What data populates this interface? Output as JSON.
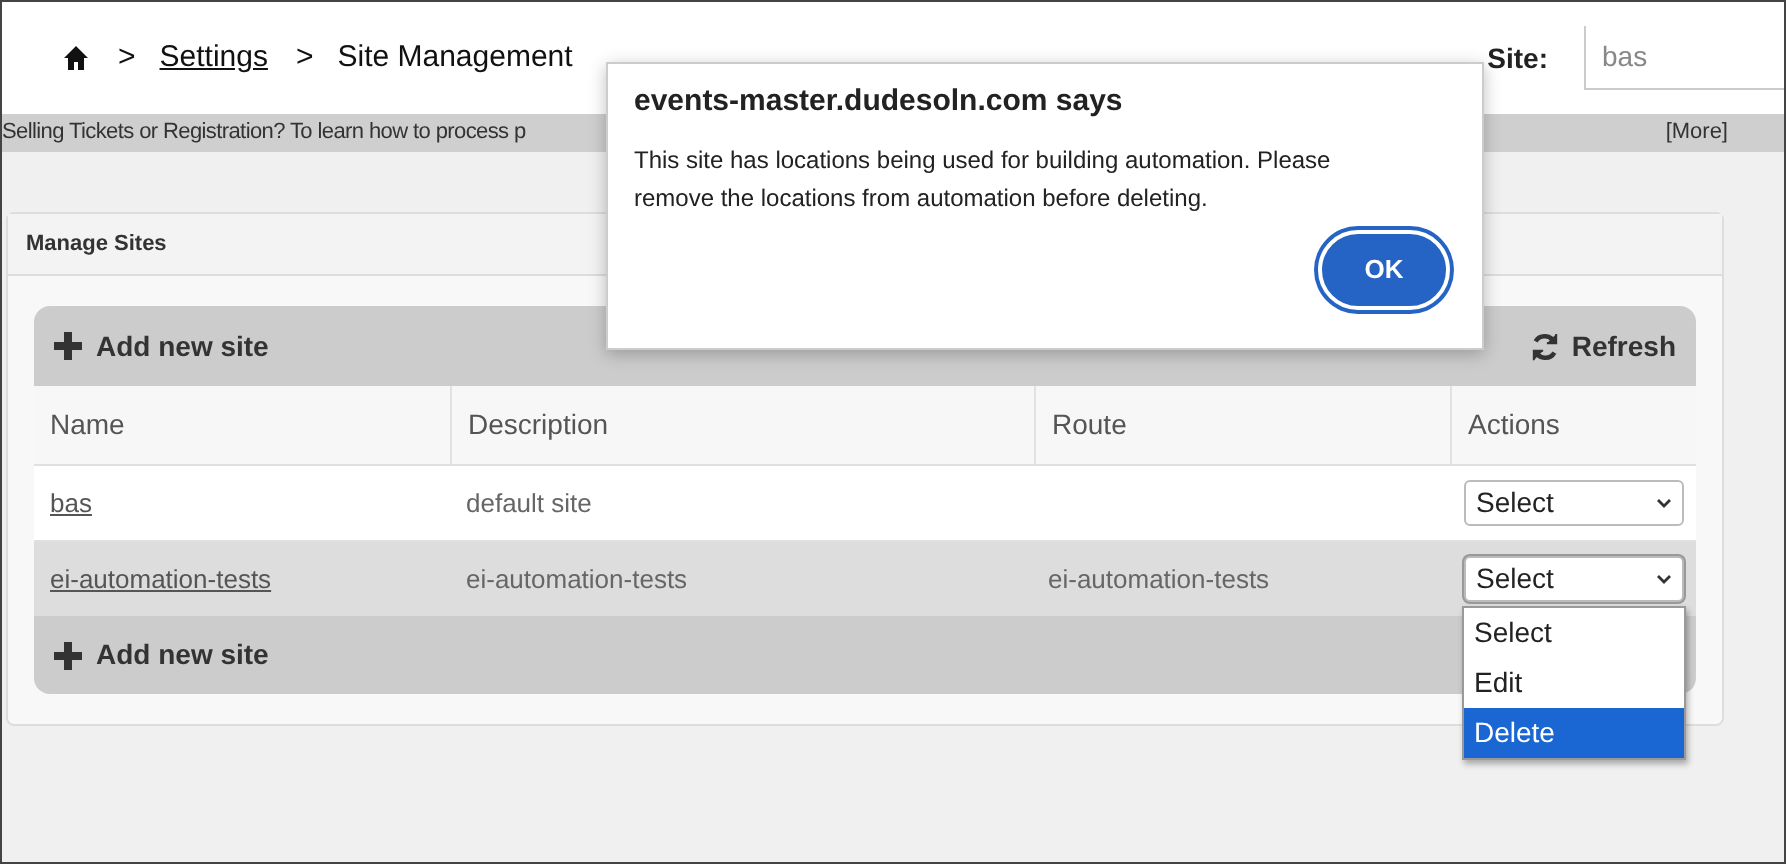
{
  "breadcrumb": {
    "items": [
      {
        "separator": ">",
        "label": "Settings",
        "link": true
      },
      {
        "separator": ">",
        "label": "Site Management",
        "link": false
      }
    ]
  },
  "site_field": {
    "label": "Site:",
    "value": "bas"
  },
  "notice": {
    "text": "Selling Tickets or Registration? To learn how to process p",
    "more": "[More]"
  },
  "panel": {
    "title": "Manage Sites"
  },
  "toolbar": {
    "add": "Add new site",
    "refresh": "Refresh"
  },
  "table": {
    "columns": [
      "Name",
      "Description",
      "Route",
      "Actions"
    ],
    "rows": [
      {
        "name": "bas",
        "description": "default site",
        "route": "",
        "action": "Select",
        "open": false
      },
      {
        "name": "ei-automation-tests",
        "description": "ei-automation-tests",
        "route": "ei-automation-tests",
        "action": "Select",
        "open": true
      }
    ]
  },
  "footer": {
    "add": "Add new site"
  },
  "menu": {
    "options": [
      {
        "label": "Select",
        "selected": false
      },
      {
        "label": "Edit",
        "selected": false
      },
      {
        "label": "Delete",
        "selected": true
      }
    ]
  },
  "dialog": {
    "title": "events-master.dudesoln.com says",
    "message": "This site has locations being used for building automation. Please remove the locations from automation before deleting.",
    "ok": "OK"
  }
}
